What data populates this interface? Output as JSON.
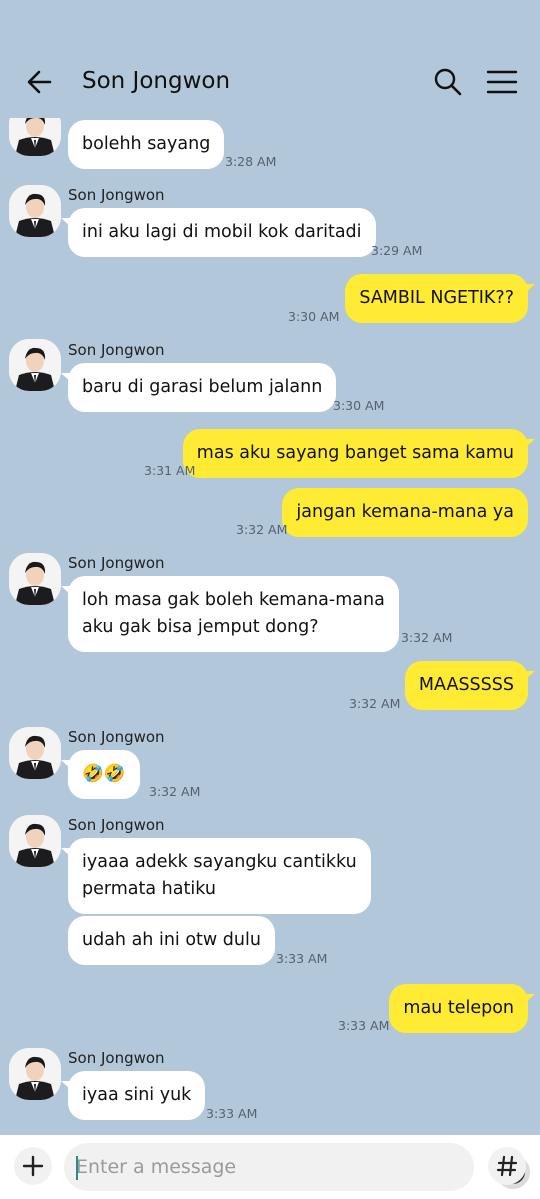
{
  "header": {
    "title": "Son Jongwon"
  },
  "messages": [
    {
      "dir": "in",
      "text": "bolehh sayang",
      "time": "3:28 AM"
    },
    {
      "dir": "in",
      "sender": "Son Jongwon",
      "text": "ini aku lagi di mobil kok daritadi",
      "time": "3:29 AM"
    },
    {
      "dir": "out",
      "text": "SAMBIL NGETIK??",
      "time": "3:30 AM"
    },
    {
      "dir": "in",
      "sender": "Son Jongwon",
      "text": "baru di garasi belum jalann",
      "time": "3:30 AM"
    },
    {
      "dir": "out",
      "text": "mas aku sayang banget sama kamu",
      "time": "3:31 AM"
    },
    {
      "dir": "out",
      "text": "jangan kemana-mana ya",
      "time": "3:32 AM"
    },
    {
      "dir": "in",
      "sender": "Son Jongwon",
      "text_line1": "loh masa gak boleh kemana-mana",
      "text_line2": "aku gak bisa jemput dong?",
      "time": "3:32 AM"
    },
    {
      "dir": "out",
      "text": "MAASSSSS",
      "time": "3:32 AM"
    },
    {
      "dir": "in",
      "sender": "Son Jongwon",
      "text": "🤣🤣",
      "time": "3:32 AM"
    },
    {
      "dir": "in",
      "sender": "Son Jongwon",
      "text_line1": "iyaaa adekk sayangku cantikku",
      "text_line2": "permata hatiku"
    },
    {
      "dir": "in",
      "text": "udah ah ini otw dulu",
      "time": "3:33 AM"
    },
    {
      "dir": "out",
      "text": "mau telepon",
      "time": "3:33 AM"
    },
    {
      "dir": "in",
      "sender": "Son Jongwon",
      "text": "iyaa sini yuk",
      "time": "3:33 AM"
    }
  ],
  "composer": {
    "placeholder": "Enter a message"
  },
  "icons": {
    "back": "back-arrow-icon",
    "search": "search-icon",
    "menu": "hamburger-menu-icon",
    "plus": "plus-icon",
    "emoji": "emoji-icon",
    "hash": "hash-icon"
  },
  "colors": {
    "background": "#b2c7d9",
    "incoming_bubble": "#ffffff",
    "outgoing_bubble": "#ffeb33"
  }
}
